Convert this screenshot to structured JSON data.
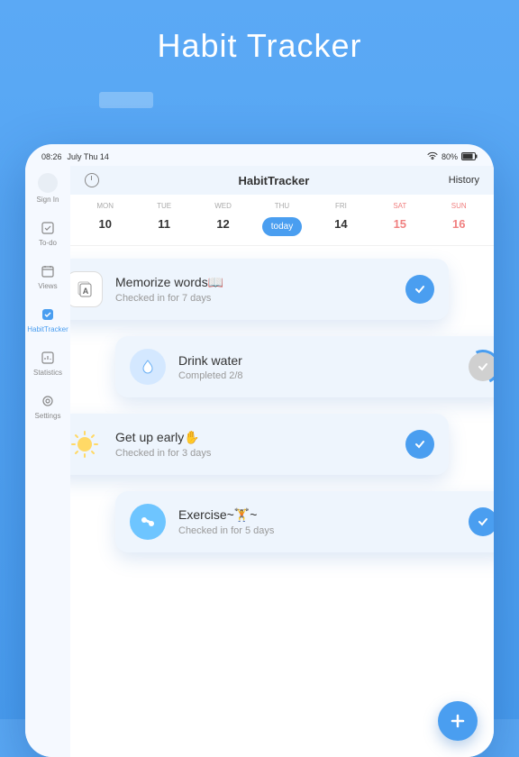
{
  "hero": {
    "title": "Habit Tracker"
  },
  "status": {
    "time": "08:26",
    "date": "July Thu 14",
    "battery": "80%"
  },
  "sidebar": {
    "items": [
      {
        "label": "Sign In"
      },
      {
        "label": "To-do"
      },
      {
        "label": "Views"
      },
      {
        "label": "HabitTracker"
      },
      {
        "label": "Statistics"
      },
      {
        "label": "Settings"
      }
    ]
  },
  "topbar": {
    "title": "HabitTracker",
    "history": "History"
  },
  "calendar": {
    "days": [
      {
        "label": "MON",
        "num": "10"
      },
      {
        "label": "TUE",
        "num": "11"
      },
      {
        "label": "WED",
        "num": "12"
      },
      {
        "label": "THU",
        "num": "today"
      },
      {
        "label": "FRI",
        "num": "14"
      },
      {
        "label": "SAT",
        "num": "15"
      },
      {
        "label": "SUN",
        "num": "16"
      }
    ]
  },
  "habits": [
    {
      "title": "Memorize words📖",
      "sub": "Checked in for 7 days"
    },
    {
      "title": "Drink water",
      "sub": "Completed 2/8"
    },
    {
      "title": "Get up early✋",
      "sub": "Checked in for 3 days"
    },
    {
      "title": "Exercise~🏋️~",
      "sub": "Checked in for 5 days"
    }
  ]
}
